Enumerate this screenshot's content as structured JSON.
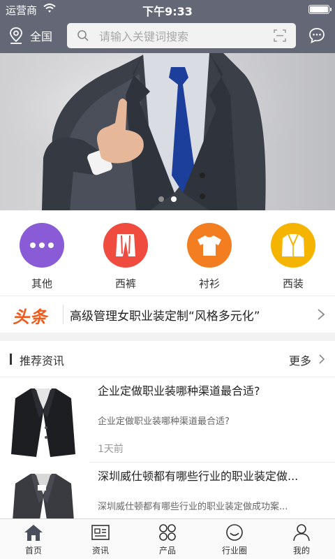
{
  "status_bar": {
    "carrier": "运营商",
    "time": "下午9:33",
    "battery_level": 1.0
  },
  "top_bar": {
    "location_label": "全国",
    "search_placeholder": "请输入关键词搜索"
  },
  "banner": {
    "slide_count": 2,
    "active_slide": 2
  },
  "categories": [
    {
      "label": "其他",
      "color": "#8a5bd6",
      "icon": "more-dots-icon"
    },
    {
      "label": "西裤",
      "color": "#ef4b3f",
      "icon": "trousers-icon"
    },
    {
      "label": "衬衫",
      "color": "#f27e21",
      "icon": "shirt-icon"
    },
    {
      "label": "西装",
      "color": "#f5b400",
      "icon": "suit-icon"
    }
  ],
  "headline": {
    "tag": "头条",
    "text": "高级管理女职业装定制“风格多元化”"
  },
  "recommended": {
    "title": "推荐资讯",
    "more_label": "更多",
    "items": [
      {
        "title": "企业定做职业装哪种渠道最合适?",
        "desc": "企业定做职业装哪种渠道最合适?",
        "time": "1天前"
      },
      {
        "title": "深圳威仕顿都有哪些行业的职业装定做...",
        "desc": "深圳威仕顿都有哪些行业的职业装定做成功案..."
      }
    ]
  },
  "tab_bar": {
    "tabs": [
      {
        "label": "首页",
        "icon": "home-icon"
      },
      {
        "label": "资讯",
        "icon": "news-icon"
      },
      {
        "label": "产品",
        "icon": "products-icon"
      },
      {
        "label": "行业圈",
        "icon": "smiley-icon"
      },
      {
        "label": "我的",
        "icon": "user-icon"
      }
    ]
  },
  "colors": {
    "header_bg": "#646876",
    "headline_tag": "#f15a1d",
    "home_tab_active": "#4a4f5c"
  }
}
